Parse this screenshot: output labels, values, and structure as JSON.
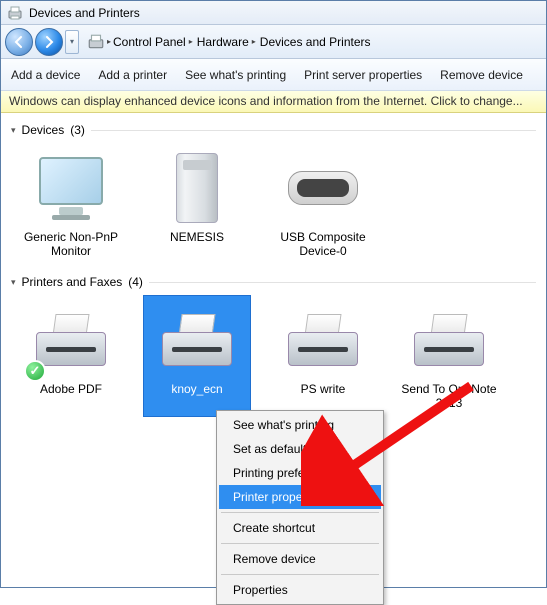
{
  "window": {
    "title": "Devices and Printers"
  },
  "breadcrumb": {
    "parts": [
      "Control Panel",
      "Hardware",
      "Devices and Printers"
    ]
  },
  "toolbar": {
    "add_device": "Add a device",
    "add_printer": "Add a printer",
    "see_printing": "See what's printing",
    "print_server": "Print server properties",
    "remove_device": "Remove device"
  },
  "infobar": {
    "text": "Windows can display enhanced device icons and information from the Internet. Click to change..."
  },
  "groups": {
    "devices": {
      "title": "Devices",
      "count": "(3)",
      "items": [
        {
          "label": "Generic Non-PnP Monitor",
          "kind": "monitor"
        },
        {
          "label": "NEMESIS",
          "kind": "tower"
        },
        {
          "label": "USB Composite Device-0",
          "kind": "usb"
        }
      ]
    },
    "printers": {
      "title": "Printers and Faxes",
      "count": "(4)",
      "items": [
        {
          "label": "Adobe PDF",
          "kind": "printer",
          "default": true
        },
        {
          "label": "knoy_ecn",
          "kind": "printer",
          "selected": true
        },
        {
          "label": "PS write",
          "kind": "printer"
        },
        {
          "label": "Send To OneNote 2013",
          "kind": "printer"
        }
      ]
    }
  },
  "context_menu": {
    "items": [
      "See what's printing",
      "Set as default printer",
      "Printing preferences",
      "Printer properties",
      "Create shortcut",
      "Remove device",
      "Properties"
    ],
    "highlighted_index": 3,
    "separators_after": [
      3,
      4,
      5
    ]
  }
}
